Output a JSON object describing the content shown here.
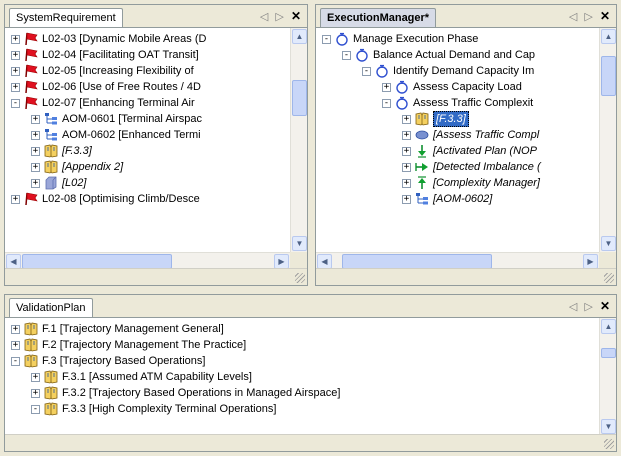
{
  "colors": {
    "selection": "#316ac5",
    "tab_active": "#d7dbe7",
    "chrome": "#ece9d8",
    "border": "#919b9c"
  },
  "tab_controls": {
    "prev": "◁",
    "next": "▷",
    "close": "✕"
  },
  "panels": {
    "system_requirement": {
      "tab": "SystemRequirement",
      "rows": [
        {
          "depth": 0,
          "expander": "+",
          "icon": "red-flag-icon",
          "label": "L02-03 [Dynamic Mobile Areas (D",
          "italic": false
        },
        {
          "depth": 0,
          "expander": "+",
          "icon": "red-flag-icon",
          "label": "L02-04 [Facilitating OAT Transit]",
          "italic": false
        },
        {
          "depth": 0,
          "expander": "+",
          "icon": "red-flag-icon",
          "label": "L02-05 [Increasing Flexibility of",
          "italic": false
        },
        {
          "depth": 0,
          "expander": "+",
          "icon": "red-flag-icon",
          "label": "L02-06 [Use of Free Routes / 4D",
          "italic": false
        },
        {
          "depth": 0,
          "expander": "-",
          "icon": "red-flag-icon",
          "label": "L02-07 [Enhancing Terminal Air",
          "italic": false
        },
        {
          "depth": 1,
          "expander": "+",
          "icon": "hierarchy-icon",
          "label": "AOM-0601  [Terminal Airspac",
          "italic": false
        },
        {
          "depth": 1,
          "expander": "+",
          "icon": "hierarchy-icon",
          "label": "AOM-0602  [Enhanced Termi",
          "italic": false
        },
        {
          "depth": 1,
          "expander": "+",
          "icon": "book-icon",
          "label": "[F.3.3]",
          "italic": true
        },
        {
          "depth": 1,
          "expander": "+",
          "icon": "book-icon",
          "label": "[Appendix 2]",
          "italic": true
        },
        {
          "depth": 1,
          "expander": "+",
          "icon": "package-icon",
          "label": "[L02]",
          "italic": true
        },
        {
          "depth": 0,
          "expander": "+",
          "icon": "red-flag-icon",
          "label": "L02-08 [Optimising Climb/Desce",
          "italic": false
        }
      ]
    },
    "execution_manager": {
      "tab": "ExecutionManager*",
      "rows": [
        {
          "depth": 0,
          "expander": "-",
          "icon": "process-icon",
          "label": "Manage Execution Phase",
          "italic": false,
          "selected": false
        },
        {
          "depth": 1,
          "expander": "-",
          "icon": "process-icon",
          "label": "Balance Actual Demand and Cap",
          "italic": false,
          "selected": false
        },
        {
          "depth": 2,
          "expander": "-",
          "icon": "process-icon",
          "label": "Identify Demand Capacity Im",
          "italic": false,
          "selected": false
        },
        {
          "depth": 3,
          "expander": "+",
          "icon": "process-icon",
          "label": "Assess Capacity Load",
          "italic": false,
          "selected": false
        },
        {
          "depth": 3,
          "expander": "-",
          "icon": "process-icon",
          "label": "Assess Traffic Complexit",
          "italic": false,
          "selected": false
        },
        {
          "depth": 4,
          "expander": "+",
          "icon": "book-icon",
          "label": "[F.3.3]",
          "italic": true,
          "selected": true
        },
        {
          "depth": 4,
          "expander": "+",
          "icon": "ellipse-icon",
          "label": "[Assess Traffic Compl",
          "italic": true,
          "selected": false
        },
        {
          "depth": 4,
          "expander": "+",
          "icon": "arrow-down-icon",
          "label": "[Activated Plan (NOP",
          "italic": true,
          "selected": false
        },
        {
          "depth": 4,
          "expander": "+",
          "icon": "arrow-right-icon",
          "label": "[Detected Imbalance (",
          "italic": true,
          "selected": false
        },
        {
          "depth": 4,
          "expander": "+",
          "icon": "arrow-up-icon",
          "label": "[Complexity Manager]",
          "italic": true,
          "selected": false
        },
        {
          "depth": 4,
          "expander": "+",
          "icon": "hierarchy-icon",
          "label": "[AOM-0602]",
          "italic": true,
          "selected": false
        }
      ]
    },
    "validation_plan": {
      "tab": "ValidationPlan",
      "rows": [
        {
          "depth": 0,
          "expander": "+",
          "icon": "book-icon",
          "label": "F.1  [Trajectory Management General]"
        },
        {
          "depth": 0,
          "expander": "+",
          "icon": "book-icon",
          "label": "F.2  [Trajectory Management The Practice]"
        },
        {
          "depth": 0,
          "expander": "-",
          "icon": "book-icon",
          "label": "F.3  [Trajectory Based Operations]"
        },
        {
          "depth": 1,
          "expander": "+",
          "icon": "book-icon",
          "label": "F.3.1  [Assumed ATM Capability Levels]"
        },
        {
          "depth": 1,
          "expander": "+",
          "icon": "book-icon",
          "label": "F.3.2  [Trajectory Based Operations in Managed Airspace]"
        },
        {
          "depth": 1,
          "expander": "-",
          "icon": "book-icon",
          "label": "F.3.3  [High Complexity Terminal Operations]"
        }
      ]
    }
  }
}
